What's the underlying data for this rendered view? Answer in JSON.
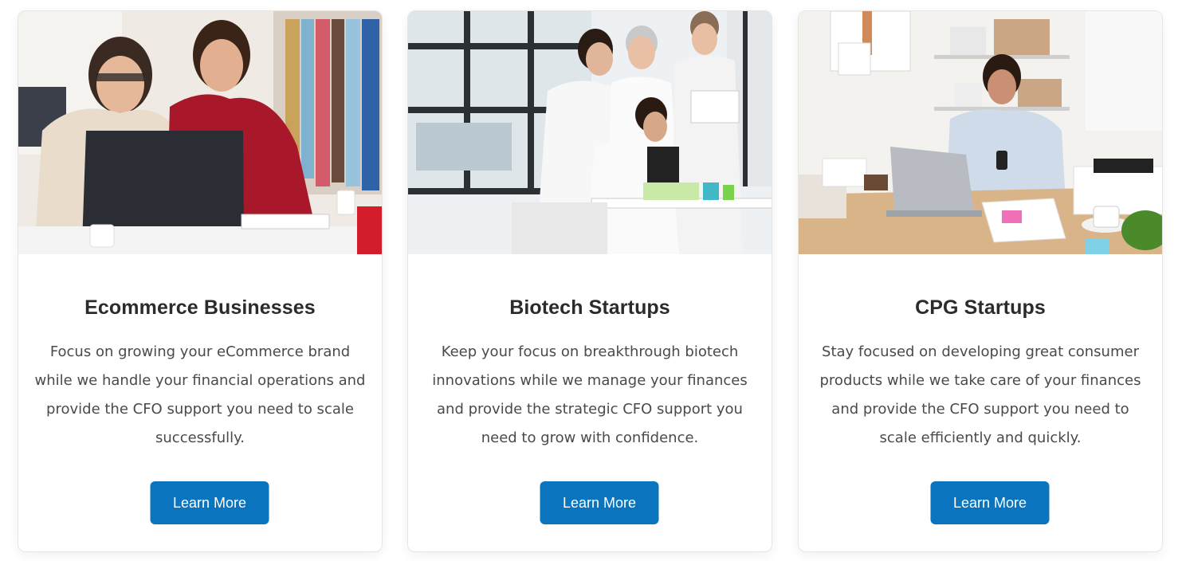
{
  "cards": [
    {
      "title": "Ecommerce Businesses",
      "description": "Focus on growing your eCommerce brand while we handle your financial operations and provide the CFO support you need to scale successfully.",
      "button_label": "Learn More",
      "image": "photo-two-women-laptop"
    },
    {
      "title": "Biotech Startups",
      "description": "Keep your focus on breakthrough biotech innovations while we manage your finances and provide the strategic CFO support you need to grow with confidence.",
      "button_label": "Learn More",
      "image": "photo-lab-scientists-microscope"
    },
    {
      "title": "CPG Startups",
      "description": "Stay focused on developing great consumer products while we take care of your finances and provide the CFO support you need to scale efficiently and quickly.",
      "button_label": "Learn More",
      "image": "photo-woman-desk-packages"
    }
  ],
  "colors": {
    "button": "#0a74be",
    "title": "#2b2b2b",
    "text": "#4a4a4a"
  }
}
